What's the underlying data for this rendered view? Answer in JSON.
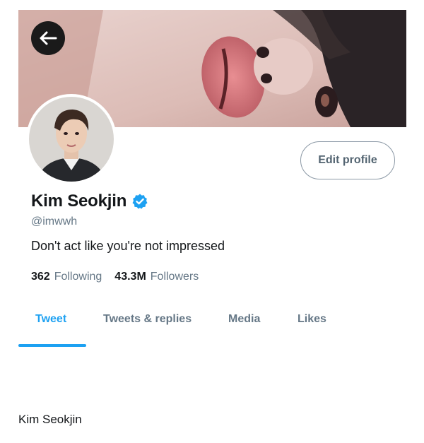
{
  "header": {
    "back_icon": "arrow-left-icon"
  },
  "profile": {
    "display_name": "Kim Seokjin",
    "verified_icon": "verified-badge-icon",
    "handle": "@imwwh",
    "bio": "Don't act like you're not impressed",
    "edit_button_label": "Edit profile"
  },
  "stats": {
    "following_count": "362",
    "following_label": "Following",
    "followers_count": "43.3M",
    "followers_label": "Followers"
  },
  "tabs": [
    {
      "label": "Tweet",
      "active": true
    },
    {
      "label": "Tweets & replies",
      "active": false
    },
    {
      "label": "Media",
      "active": false
    },
    {
      "label": "Likes",
      "active": false
    }
  ],
  "content": {
    "text": "Kim Seokjin"
  },
  "colors": {
    "accent": "#1da1f2",
    "muted": "#657786"
  }
}
